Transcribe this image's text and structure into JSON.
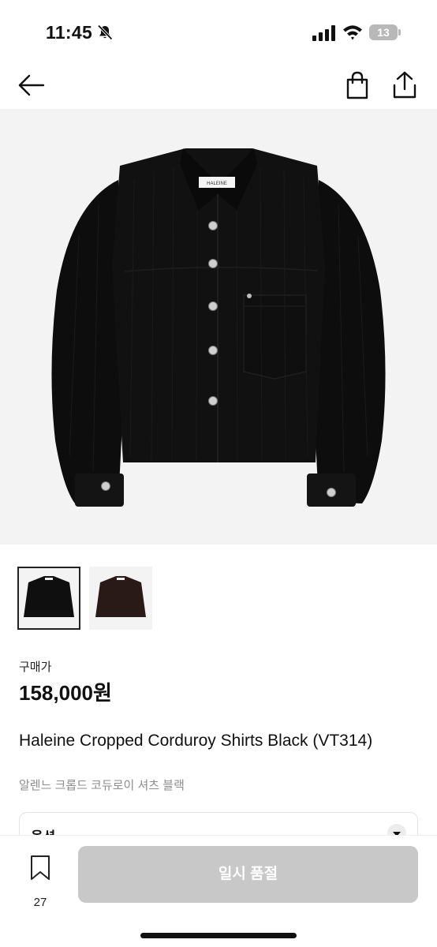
{
  "status_bar": {
    "time": "11:45",
    "battery": "13"
  },
  "nav": {
    "icons": [
      "back-arrow-icon",
      "shopping-bag-icon",
      "share-icon"
    ]
  },
  "product": {
    "price_label": "구매가",
    "price": "158,000원",
    "name": "Haleine Cropped Corduroy Shirts Black (VT314)",
    "subname": "알렌느 크롭드 코듀로이 셔츠 블랙",
    "shirt_label": "HALEINE",
    "thumbnails": [
      {
        "selected": true,
        "color": "#0f0f0f"
      },
      {
        "selected": false,
        "color": "#2a1a17"
      }
    ]
  },
  "option": {
    "label": "옵션"
  },
  "bottom_bar": {
    "bookmark_count": "27",
    "sold_out_label": "일시 품절"
  }
}
